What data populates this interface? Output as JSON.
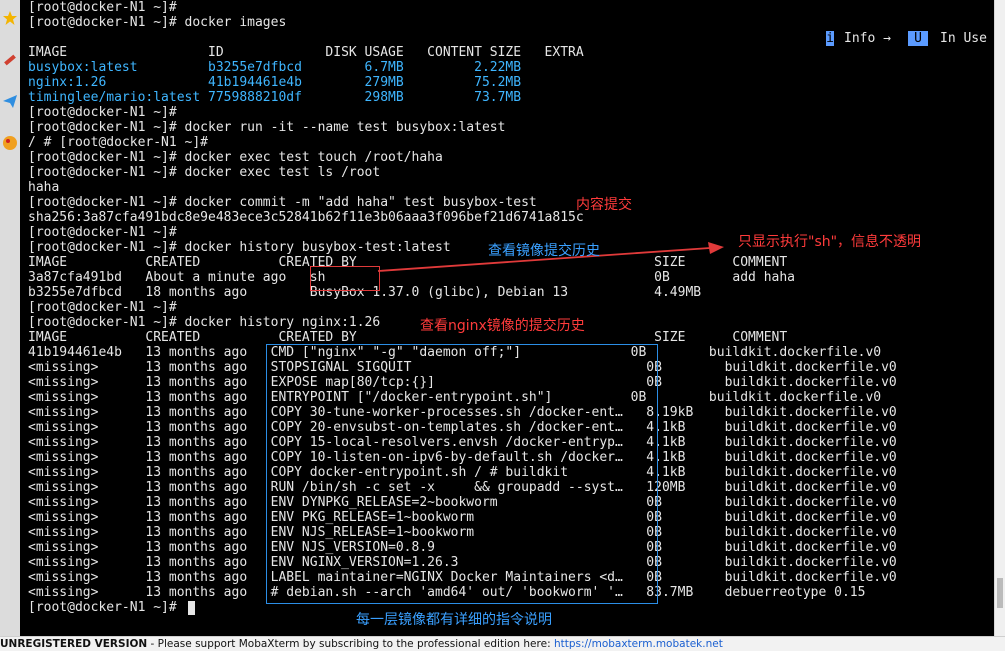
{
  "terminal": {
    "lines": [
      "[root@docker-N1 ~]#",
      "[root@docker-N1 ~]# docker images",
      "",
      "IMAGE                  ID             DISK USAGE   CONTENT SIZE   EXTRA",
      "busybox:latest         b3255e7dfbcd        6.7MB         2.22MB",
      "nginx:1.26             41b194461e4b        279MB         75.2MB",
      "timinglee/mario:latest 7759888210df        298MB         73.7MB",
      "[root@docker-N1 ~]#",
      "[root@docker-N1 ~]# docker run -it --name test busybox:latest",
      "/ # [root@docker-N1 ~]#",
      "[root@docker-N1 ~]# docker exec test touch /root/haha",
      "[root@docker-N1 ~]# docker exec test ls /root",
      "haha",
      "[root@docker-N1 ~]# docker commit -m \"add haha\" test busybox-test",
      "sha256:3a87cfa491bdc8e9e483ece3c52841b62f11e3b06aaa3f096bef21d6741a815c",
      "[root@docker-N1 ~]#",
      "[root@docker-N1 ~]# docker history busybox-test:latest",
      "IMAGE          CREATED          CREATED BY                                      SIZE      COMMENT",
      "3a87cfa491bd   About a minute ago   sh                                          0B        add haha",
      "b3255e7dfbcd   18 months ago        BusyBox 1.37.0 (glibc), Debian 13           4.49MB",
      "[root@docker-N1 ~]#",
      "[root@docker-N1 ~]# docker history nginx:1.26",
      "IMAGE          CREATED          CREATED BY                                      SIZE      COMMENT",
      "41b194461e4b   13 months ago   CMD [\"nginx\" \"-g\" \"daemon off;\"]              0B        buildkit.dockerfile.v0",
      "<missing>      13 months ago   STOPSIGNAL SIGQUIT                              0B        buildkit.dockerfile.v0",
      "<missing>      13 months ago   EXPOSE map[80/tcp:{}]                           0B        buildkit.dockerfile.v0",
      "<missing>      13 months ago   ENTRYPOINT [\"/docker-entrypoint.sh\"]          0B        buildkit.dockerfile.v0",
      "<missing>      13 months ago   COPY 30-tune-worker-processes.sh /docker-ent…   8.19kB    buildkit.dockerfile.v0",
      "<missing>      13 months ago   COPY 20-envsubst-on-templates.sh /docker-ent…   4.1kB     buildkit.dockerfile.v0",
      "<missing>      13 months ago   COPY 15-local-resolvers.envsh /docker-entryp…   4.1kB     buildkit.dockerfile.v0",
      "<missing>      13 months ago   COPY 10-listen-on-ipv6-by-default.sh /docker…   4.1kB     buildkit.dockerfile.v0",
      "<missing>      13 months ago   COPY docker-entrypoint.sh / # buildkit          4.1kB     buildkit.dockerfile.v0",
      "<missing>      13 months ago   RUN /bin/sh -c set -x     && groupadd --syst…   120MB     buildkit.dockerfile.v0",
      "<missing>      13 months ago   ENV DYNPKG_RELEASE=2~bookworm                   0B        buildkit.dockerfile.v0",
      "<missing>      13 months ago   ENV PKG_RELEASE=1~bookworm                      0B        buildkit.dockerfile.v0",
      "<missing>      13 months ago   ENV NJS_RELEASE=1~bookworm                      0B        buildkit.dockerfile.v0",
      "<missing>      13 months ago   ENV NJS_VERSION=0.8.9                           0B        buildkit.dockerfile.v0",
      "<missing>      13 months ago   ENV NGINX_VERSION=1.26.3                        0B        buildkit.dockerfile.v0",
      "<missing>      13 months ago   LABEL maintainer=NGINX Docker Maintainers <d…   0B        buildkit.dockerfile.v0",
      "<missing>      13 months ago   # debian.sh --arch 'amd64' out/ 'bookworm' '…   83.7MB    debuerreotype 0.15",
      "[root@docker-N1 ~]#"
    ]
  },
  "legend": {
    "info_icon": "i",
    "info_label": "Info →",
    "u_badge": "U",
    "inuse_label": "In Use"
  },
  "annotations": {
    "commit": "内容提交",
    "history_busybox": "查看镜像提交历史",
    "sh_only": "只显示执行\"sh\"，信息不透明",
    "history_nginx": "查看nginx镜像的提交历史",
    "layers": "每一层镜像都有详细的指令说明"
  },
  "statusbar": {
    "bold": "UNREGISTERED VERSION",
    "text": " -  Please support MobaXterm by subscribing to the professional edition here:  ",
    "link": "https://mobaxterm.mobatek.net"
  },
  "colors": {
    "annotation_red": "#ff3b3b",
    "annotation_blue": "#3aa0ff",
    "terminal_bg": "#000000",
    "terminal_fg": "#e6e6e6"
  }
}
